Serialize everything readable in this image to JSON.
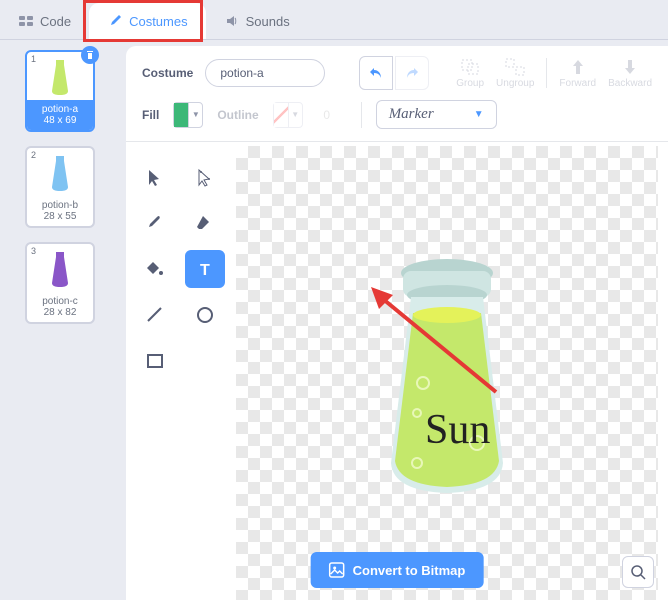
{
  "tabs": {
    "code": "Code",
    "costumes": "Costumes",
    "sounds": "Sounds"
  },
  "costume_label": "Costume",
  "costume_name": "potion-a",
  "fill_label": "Fill",
  "fill_color": "#3cb878",
  "outline_label": "Outline",
  "outline_value": "0",
  "font_name": "Marker",
  "actions": {
    "group": "Group",
    "ungroup": "Ungroup",
    "forward": "Forward",
    "backward": "Backward"
  },
  "thumbs": [
    {
      "num": "1",
      "name": "potion-a",
      "dims": "48 x 69",
      "selected": true,
      "fill": "#c4e86b"
    },
    {
      "num": "2",
      "name": "potion-b",
      "dims": "28 x 55",
      "selected": false,
      "fill": "#7fc3f2"
    },
    {
      "num": "3",
      "name": "potion-c",
      "dims": "28 x 82",
      "selected": false,
      "fill": "#8a56c8"
    }
  ],
  "tools": [
    {
      "id": "select",
      "sel": false
    },
    {
      "id": "reshape",
      "sel": false
    },
    {
      "id": "brush",
      "sel": false
    },
    {
      "id": "eraser",
      "sel": false
    },
    {
      "id": "fill",
      "sel": false
    },
    {
      "id": "text",
      "sel": true
    },
    {
      "id": "line",
      "sel": false
    },
    {
      "id": "circle",
      "sel": false
    },
    {
      "id": "rect",
      "sel": false
    }
  ],
  "canvas_text": "Sun",
  "convert_label": "Convert to Bitmap"
}
